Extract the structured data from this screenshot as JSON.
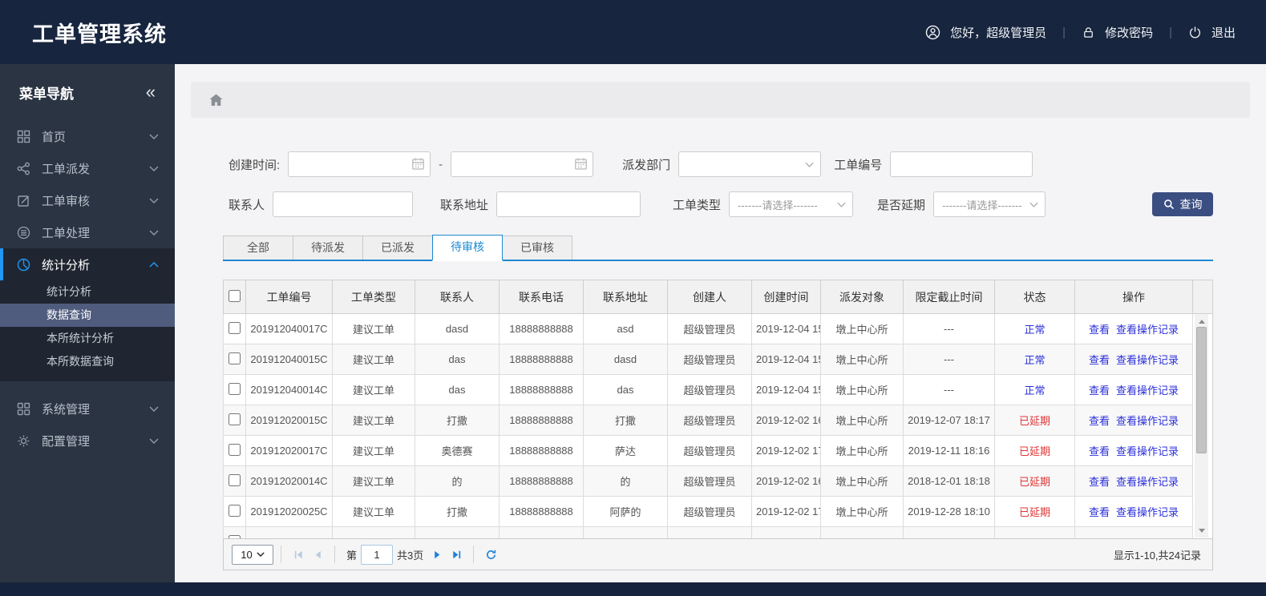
{
  "colors": {
    "header_bg": "#17253e",
    "sidebar_bg": "#2b3442",
    "accent": "#2196f3",
    "tab_active": "#1e88d2",
    "link": "#2b2fd9",
    "status_normal": "#2b2fd9",
    "status_overdue": "#e03434",
    "search_button": "#3b4e82"
  },
  "header": {
    "title": "工单管理系统",
    "greeting": "您好，超级管理员",
    "change_password": "修改密码",
    "logout": "退出"
  },
  "sidebar": {
    "title": "菜单导航",
    "collapse_glyph": "«",
    "items": [
      {
        "label": "首页"
      },
      {
        "label": "工单派发"
      },
      {
        "label": "工单审核"
      },
      {
        "label": "工单处理"
      },
      {
        "label": "统计分析",
        "children": [
          "统计分析",
          "数据查询",
          "本所统计分析",
          "本所数据查询"
        ],
        "active_child_index": 1
      },
      {
        "label": "系统管理"
      },
      {
        "label": "配置管理"
      }
    ]
  },
  "filters": {
    "create_time_label": "创建时间:",
    "range_separator": "-",
    "dispatch_dept_label": "派发部门",
    "order_no_label": "工单编号",
    "contact_label": "联系人",
    "address_label": "联系地址",
    "order_type_label": "工单类型",
    "delay_label": "是否延期",
    "select_placeholder": "-------请选择-------",
    "search_button": "查询"
  },
  "tabs": [
    {
      "label": "全部"
    },
    {
      "label": "待派发"
    },
    {
      "label": "已派发"
    },
    {
      "label": "待审核",
      "active": true
    },
    {
      "label": "已审核"
    }
  ],
  "table": {
    "columns": [
      "工单编号",
      "工单类型",
      "联系人",
      "联系电话",
      "联系地址",
      "创建人",
      "创建时间",
      "派发对象",
      "限定截止时间",
      "状态",
      "操作"
    ],
    "rows": [
      {
        "order_no": "201912040017C",
        "type": "建议工单",
        "contact": "dasd",
        "phone": "18888888888",
        "address": "asd",
        "creator": "超级管理员",
        "created": "2019-12-04 15",
        "target": "墩上中心所",
        "deadline": "---",
        "status": "正常",
        "status_key": "normal",
        "action1": "查看",
        "action2": "查看操作记录"
      },
      {
        "order_no": "201912040015C",
        "type": "建议工单",
        "contact": "das",
        "phone": "18888888888",
        "address": "dasd",
        "creator": "超级管理员",
        "created": "2019-12-04 15",
        "target": "墩上中心所",
        "deadline": "---",
        "status": "正常",
        "status_key": "normal",
        "action1": "查看",
        "action2": "查看操作记录"
      },
      {
        "order_no": "201912040014C",
        "type": "建议工单",
        "contact": "das",
        "phone": "18888888888",
        "address": "das",
        "creator": "超级管理员",
        "created": "2019-12-04 15",
        "target": "墩上中心所",
        "deadline": "---",
        "status": "正常",
        "status_key": "normal",
        "action1": "查看",
        "action2": "查看操作记录"
      },
      {
        "order_no": "201912020015C",
        "type": "建议工单",
        "contact": "打撒",
        "phone": "18888888888",
        "address": "打撒",
        "creator": "超级管理员",
        "created": "2019-12-02 16",
        "target": "墩上中心所",
        "deadline": "2019-12-07 18:17",
        "status": "已延期",
        "status_key": "overdue",
        "action1": "查看",
        "action2": "查看操作记录"
      },
      {
        "order_no": "201912020017C",
        "type": "建议工单",
        "contact": "奥德赛",
        "phone": "18888888888",
        "address": "萨达",
        "creator": "超级管理员",
        "created": "2019-12-02 17",
        "target": "墩上中心所",
        "deadline": "2019-12-11 18:16",
        "status": "已延期",
        "status_key": "overdue",
        "action1": "查看",
        "action2": "查看操作记录"
      },
      {
        "order_no": "201912020014C",
        "type": "建议工单",
        "contact": "的",
        "phone": "18888888888",
        "address": "的",
        "creator": "超级管理员",
        "created": "2019-12-02 16",
        "target": "墩上中心所",
        "deadline": "2018-12-01 18:18",
        "status": "已延期",
        "status_key": "overdue",
        "action1": "查看",
        "action2": "查看操作记录"
      },
      {
        "order_no": "201912020025C",
        "type": "建议工单",
        "contact": "打撒",
        "phone": "18888888888",
        "address": "阿萨的",
        "creator": "超级管理员",
        "created": "2019-12-02 17",
        "target": "墩上中心所",
        "deadline": "2019-12-28 18:10",
        "status": "已延期",
        "status_key": "overdue",
        "action1": "查看",
        "action2": "查看操作记录"
      },
      {
        "order_no": "",
        "type": "",
        "contact": "",
        "phone": "",
        "address": "",
        "creator": "",
        "created": "",
        "target": "",
        "deadline": "",
        "status": "",
        "status_key": "",
        "action1": "",
        "action2": ""
      }
    ]
  },
  "pager": {
    "page_size": "10",
    "page_prefix": "第",
    "page_value": "1",
    "total_pages": "共3页",
    "summary": "显示1-10,共24记录"
  }
}
